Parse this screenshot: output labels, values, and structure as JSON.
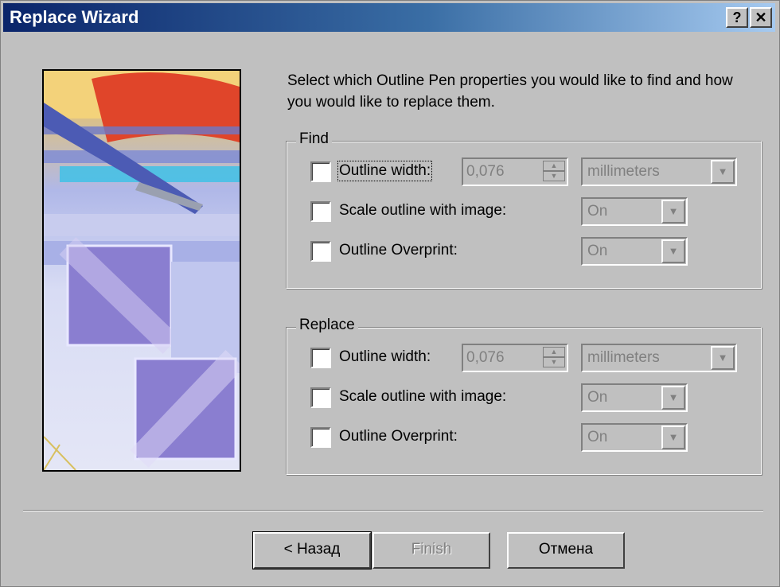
{
  "window": {
    "title": "Replace Wizard",
    "help_label": "?",
    "close_label": "✕"
  },
  "description": "Select which Outline Pen properties you would like to find and how you would like to replace them.",
  "find": {
    "legend": "Find",
    "outline_width": {
      "label": "Outline width:",
      "checked": false,
      "value": "0,076",
      "unit": "millimeters"
    },
    "scale_outline": {
      "label": "Scale outline with image:",
      "checked": false,
      "value": "On"
    },
    "overprint": {
      "label": "Outline Overprint:",
      "checked": false,
      "value": "On"
    }
  },
  "replace": {
    "legend": "Replace",
    "outline_width": {
      "label": "Outline width:",
      "checked": false,
      "value": "0,076",
      "unit": "millimeters"
    },
    "scale_outline": {
      "label": "Scale outline with image:",
      "checked": false,
      "value": "On"
    },
    "overprint": {
      "label": "Outline Overprint:",
      "checked": false,
      "value": "On"
    }
  },
  "buttons": {
    "back": "< Назад",
    "finish": "Finish",
    "cancel": "Отмена"
  },
  "icons": {
    "spin_up": "▲",
    "spin_down": "▼",
    "dropdown": "▼"
  }
}
